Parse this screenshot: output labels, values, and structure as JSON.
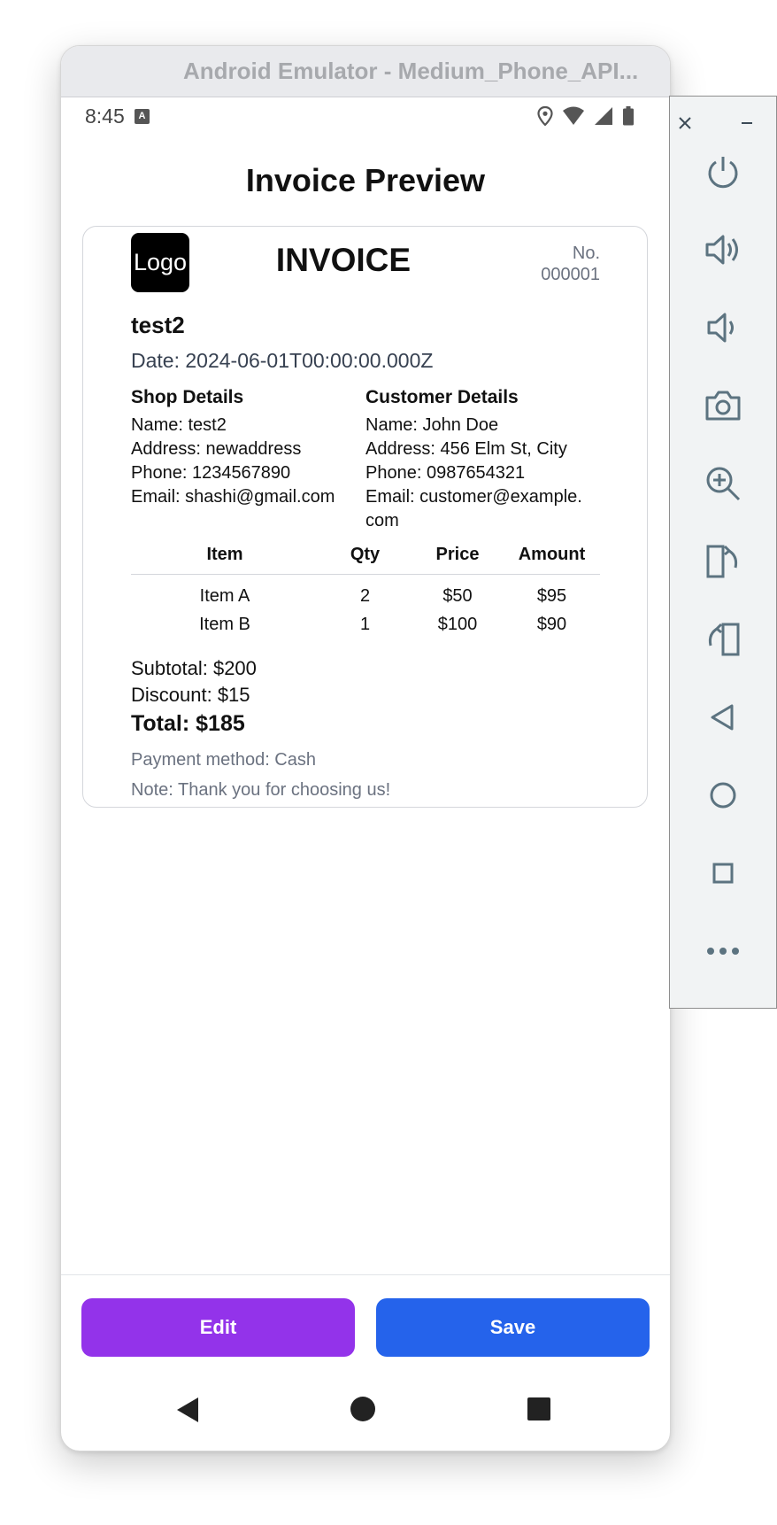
{
  "window": {
    "title": "Android Emulator - Medium_Phone_API..."
  },
  "status_bar": {
    "time": "8:45",
    "badge": "A"
  },
  "page": {
    "title": "Invoice Preview"
  },
  "invoice": {
    "logo_text": "Logo",
    "heading": "INVOICE",
    "number_label": "No.",
    "number": "000001",
    "shop_name": "test2",
    "date": "Date: 2024-06-01T00:00:00.000Z",
    "shop_details": {
      "title": "Shop Details",
      "name": "Name: test2",
      "address": "Address: newaddress",
      "phone": "Phone: 1234567890",
      "email": "Email: shashi@gmail.com"
    },
    "customer_details": {
      "title": "Customer Details",
      "name": "Name: John Doe",
      "address": "Address: 456 Elm St, City",
      "phone": "Phone: 0987654321",
      "email": "Email: customer@example.com"
    },
    "table": {
      "headers": [
        "Item",
        "Qty",
        "Price",
        "Amount"
      ],
      "rows": [
        [
          "Item A",
          "2",
          "$50",
          "$95"
        ],
        [
          "Item B",
          "1",
          "$100",
          "$90"
        ]
      ]
    },
    "subtotal": "Subtotal: $200",
    "discount": "Discount: $15",
    "total": "Total: $185",
    "payment_method": "Payment method: Cash",
    "note": "Note: Thank you for choosing us!"
  },
  "buttons": {
    "edit": "Edit",
    "save": "Save"
  },
  "colors": {
    "edit": "#9333ea",
    "save": "#2563eb",
    "muted": "#6b7280"
  },
  "emulator_controls": [
    "close-icon",
    "minimize-icon",
    "power-icon",
    "volume-up-icon",
    "volume-down-icon",
    "camera-icon",
    "zoom-in-icon",
    "rotate-left-icon",
    "rotate-right-icon",
    "back-icon",
    "home-icon",
    "overview-icon",
    "more-icon"
  ]
}
